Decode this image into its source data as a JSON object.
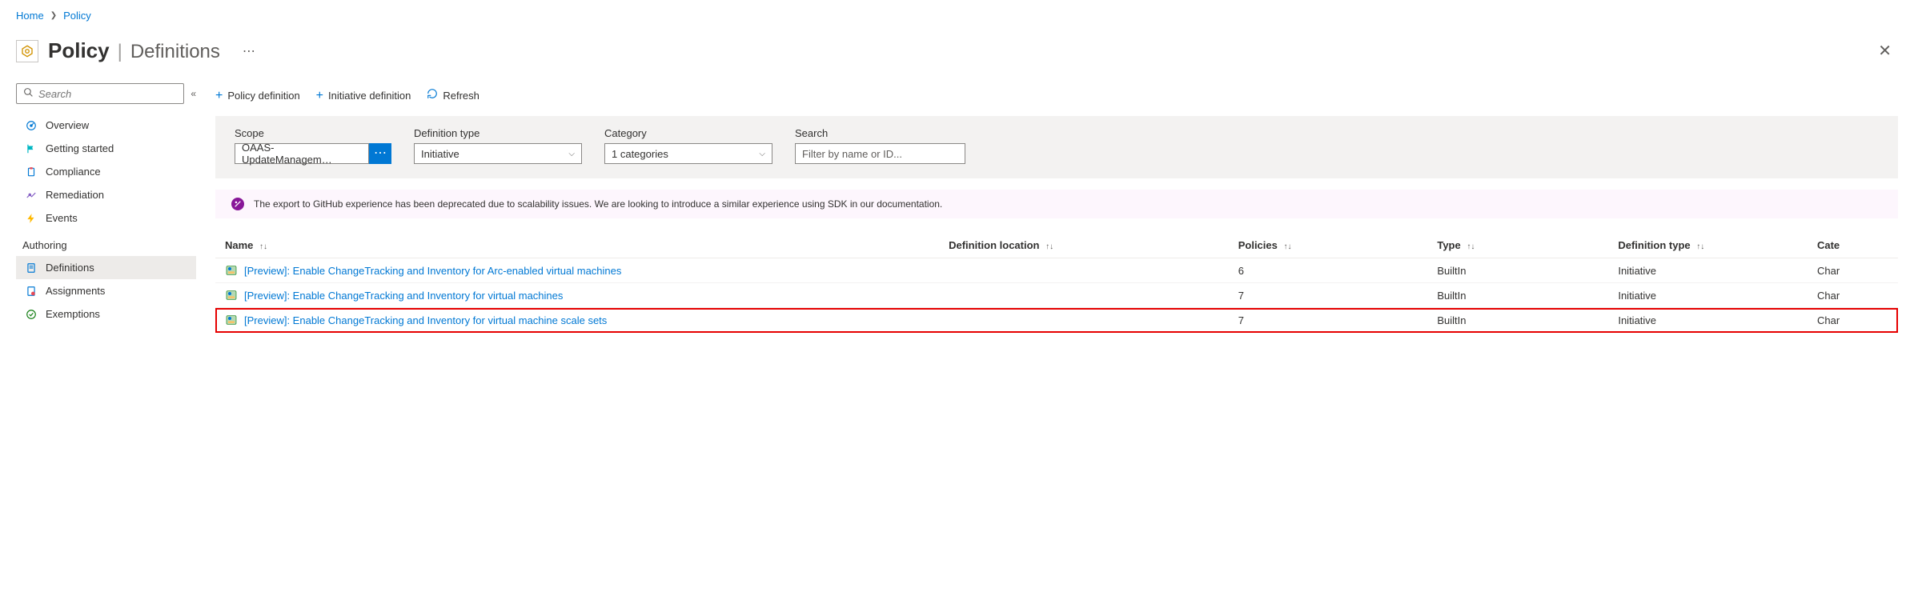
{
  "breadcrumb": {
    "home": "Home",
    "policy": "Policy"
  },
  "header": {
    "title_bold": "Policy",
    "title_light": "Definitions",
    "ellipsis": "⋯"
  },
  "sidebar": {
    "search_placeholder": "Search",
    "section_label": "Authoring",
    "items": [
      {
        "label": "Overview",
        "icon": "dashboard",
        "color": "#0078d4"
      },
      {
        "label": "Getting started",
        "icon": "flag",
        "color": "#00B7C3"
      },
      {
        "label": "Compliance",
        "icon": "clipboard",
        "color": "#0078d4"
      },
      {
        "label": "Remediation",
        "icon": "wrench",
        "color": "#8661c5"
      },
      {
        "label": "Events",
        "icon": "bolt",
        "color": "#ffb900"
      }
    ],
    "authoring_items": [
      {
        "label": "Definitions",
        "icon": "doc",
        "color": "#0078d4",
        "active": true
      },
      {
        "label": "Assignments",
        "icon": "doc-assign",
        "color": "#0078d4"
      },
      {
        "label": "Exemptions",
        "icon": "circle-slash",
        "color": "#107c10"
      }
    ]
  },
  "toolbar": {
    "policy_def": "Policy definition",
    "initiative_def": "Initiative definition",
    "refresh": "Refresh"
  },
  "filters": {
    "scope_label": "Scope",
    "scope_value": "OAAS-UpdateManagem…",
    "deftype_label": "Definition type",
    "deftype_value": "Initiative",
    "category_label": "Category",
    "category_value": "1 categories",
    "search_label": "Search",
    "search_placeholder": "Filter by name or ID..."
  },
  "banner": {
    "text": "The export to GitHub experience has been deprecated due to scalability issues. We are looking to introduce a similar experience using SDK in our documentation."
  },
  "table": {
    "columns": {
      "name": "Name",
      "location": "Definition location",
      "policies": "Policies",
      "type": "Type",
      "deftype": "Definition type",
      "category": "Cate"
    },
    "rows": [
      {
        "name": "[Preview]: Enable ChangeTracking and Inventory for Arc-enabled virtual machines",
        "location": "",
        "policies": "6",
        "type": "BuiltIn",
        "deftype": "Initiative",
        "category": "Char",
        "highlighted": false
      },
      {
        "name": "[Preview]: Enable ChangeTracking and Inventory for virtual machines",
        "location": "",
        "policies": "7",
        "type": "BuiltIn",
        "deftype": "Initiative",
        "category": "Char",
        "highlighted": false
      },
      {
        "name": "[Preview]: Enable ChangeTracking and Inventory for virtual machine scale sets",
        "location": "",
        "policies": "7",
        "type": "BuiltIn",
        "deftype": "Initiative",
        "category": "Char",
        "highlighted": true
      }
    ]
  },
  "sort_glyph": "↑↓"
}
